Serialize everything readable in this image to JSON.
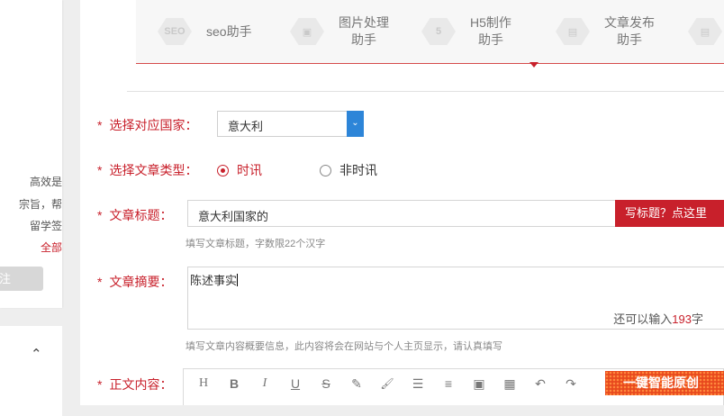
{
  "sidebar": {
    "lines": [
      "高效是",
      "宗旨，帮",
      "留学签",
      "全部"
    ],
    "follow_label": "注",
    "chevron": "^"
  },
  "tools": [
    {
      "label": "seo助手",
      "icon": "seo-icon",
      "icon_text": "SEO"
    },
    {
      "label": "图片处理\n助手",
      "icon": "image-icon",
      "icon_text": "▣"
    },
    {
      "label": "H5制作\n助手",
      "icon": "html5-icon",
      "icon_text": "5"
    },
    {
      "label": "文章发布\n助手",
      "icon": "document-icon",
      "icon_text": "▤"
    },
    {
      "label": "",
      "icon": "document-icon",
      "icon_text": "▤"
    }
  ],
  "form": {
    "country_label": "选择对应国家：",
    "country_value": "意大利",
    "type_label": "选择文章类型：",
    "type_options": [
      "时讯",
      "非时讯"
    ],
    "type_selected": "时讯",
    "title_label": "文章标题：",
    "title_value": "意大利国家的",
    "title_button": "写标题？点这里",
    "title_hint": "填写文章标题，字数限22个汉字",
    "abstract_label": "文章摘要：",
    "abstract_value": "陈述事实",
    "abstract_counter_prefix": "还可以输入",
    "abstract_counter_num": "193",
    "abstract_counter_suffix": "字",
    "abstract_hint": "填写文章内容概要信息，此内容将会在网站与个人主页显示，请认真填写",
    "content_label": "正文内容：",
    "required_mark": "*"
  },
  "editor": {
    "tools": [
      "H",
      "B",
      "I",
      "U",
      "S",
      "✎",
      "🖌",
      "☰",
      "≡",
      "▣",
      "▦",
      "↶",
      "↷"
    ],
    "smart_button": "一键智能原创"
  },
  "colors": {
    "accent": "#c8202b",
    "select_button": "#2d85d8",
    "smart_button": "#e8491e"
  }
}
